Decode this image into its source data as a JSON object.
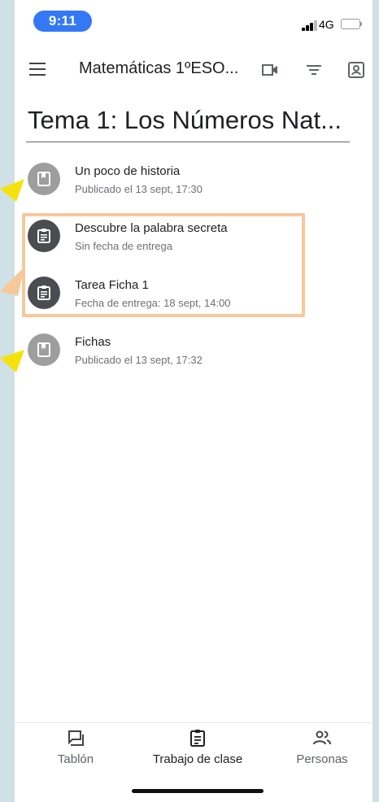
{
  "status_bar": {
    "time": "9:11",
    "network": "4G"
  },
  "app_bar": {
    "title": "Matemáticas 1ºESO..."
  },
  "topic": {
    "title": "Tema 1: Los Números Nat..."
  },
  "items": [
    {
      "title": "Un poco de historia",
      "subtitle": "Publicado el 13 sept, 17:30",
      "icon": "material-icon"
    },
    {
      "title": "Descubre la palabra secreta",
      "subtitle": "Sin fecha de entrega",
      "icon": "assignment-icon"
    },
    {
      "title": "Tarea Ficha 1",
      "subtitle": "Fecha de entrega: 18 sept, 14:00",
      "icon": "assignment-icon"
    },
    {
      "title": "Fichas",
      "subtitle": "Publicado el 13 sept, 17:32",
      "icon": "material-icon"
    }
  ],
  "bottom_nav": [
    {
      "label": "Tablón",
      "icon": "stream-icon",
      "active": false
    },
    {
      "label": "Trabajo de clase",
      "icon": "classwork-icon",
      "active": true
    },
    {
      "label": "Personas",
      "icon": "people-icon",
      "active": false
    }
  ],
  "colors": {
    "time_pill": "#3478f6",
    "material_avatar": "#9e9e9e",
    "assignment_avatar": "#4a4c50",
    "highlight": "#f7c89a",
    "arrow_yellow": "#f5e20c",
    "arrow_orange": "#f7c89a"
  }
}
